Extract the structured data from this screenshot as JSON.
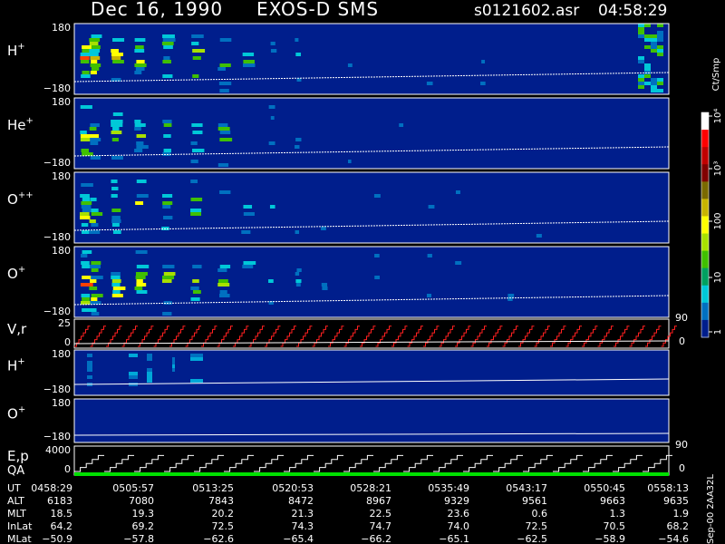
{
  "header": {
    "date": "Dec 16, 1990",
    "instrument": "EXOS-D SMS",
    "file": "s0121602.asr",
    "time": "04:58:29"
  },
  "colorbar": {
    "unit_label": "Ct/Smp",
    "ticks": [
      "10⁴",
      "10³",
      "100",
      "10",
      "1"
    ],
    "stops": [
      "#ffffff",
      "#ff0000",
      "#c00000",
      "#800000",
      "#7a6a00",
      "#c8b400",
      "#ffff00",
      "#a8e000",
      "#40c000",
      "#00a060",
      "#00c8d8",
      "#0070c0",
      "#001e8c"
    ]
  },
  "panels": [
    {
      "id": "h-plus",
      "label": "H",
      "sup": "+",
      "ytop": "180",
      "ybot": "−180",
      "kind": "spectrogram",
      "intensity": 1.0,
      "late": true
    },
    {
      "id": "he-plus",
      "label": "He",
      "sup": "+",
      "ytop": "180",
      "ybot": "−180",
      "kind": "spectrogram",
      "intensity": 0.75,
      "late": false
    },
    {
      "id": "o-plusplus",
      "label": "O",
      "sup": "++",
      "ytop": "180",
      "ybot": "−180",
      "kind": "spectrogram",
      "intensity": 0.8,
      "late": false
    },
    {
      "id": "o-plus",
      "label": "O",
      "sup": "+",
      "ytop": "180",
      "ybot": "−180",
      "kind": "spectrogram",
      "intensity": 0.95,
      "late": false
    },
    {
      "id": "v-r",
      "label": "V,r",
      "sup": "",
      "ytop": "25",
      "ybot": "0",
      "right": "90",
      "right2": "0",
      "kind": "sawtooth"
    },
    {
      "id": "h-plus-2",
      "label": "H",
      "sup": "+",
      "ytop": "180",
      "ybot": "−180",
      "kind": "spectrogram2"
    },
    {
      "id": "o-plus-2",
      "label": "O",
      "sup": "+",
      "ytop": "180",
      "ybot": "−180",
      "kind": "empty"
    },
    {
      "id": "e-p",
      "label": "E,p",
      "sup": "",
      "ytop": "4000",
      "ybot": "0",
      "right": "90",
      "right2": "0",
      "kind": "staircase"
    }
  ],
  "qa_label": "QA",
  "footer": {
    "rows": [
      {
        "label": "UT",
        "values": [
          "0458:29",
          "0505:57",
          "0513:25",
          "0520:53",
          "0528:21",
          "0535:49",
          "0543:17",
          "0550:45",
          "0558:13"
        ]
      },
      {
        "label": "ALT",
        "values": [
          "6183",
          "7080",
          "7843",
          "8472",
          "8967",
          "9329",
          "9561",
          "9663",
          "9635"
        ]
      },
      {
        "label": "MLT",
        "values": [
          "18.5",
          "19.3",
          "20.2",
          "21.3",
          "22.5",
          "23.6",
          "0.6",
          "1.3",
          "1.9"
        ]
      },
      {
        "label": "InLat",
        "values": [
          "64.2",
          "69.2",
          "72.5",
          "74.3",
          "74.7",
          "74.0",
          "72.5",
          "70.5",
          "68.2"
        ]
      },
      {
        "label": "MLat",
        "values": [
          "−50.9",
          "−57.8",
          "−62.6",
          "−65.4",
          "−66.2",
          "−65.1",
          "−62.5",
          "−58.9",
          "−54.6"
        ]
      }
    ],
    "stamp": "Sep-00  2AA32L"
  },
  "chart_data": {
    "type": "heatmap",
    "title": "Dec 16, 1990    EXOS-D SMS",
    "x": [
      "0458:29",
      "0505:57",
      "0513:25",
      "0520:53",
      "0528:21",
      "0535:49",
      "0543:17",
      "0550:45",
      "0558:13"
    ],
    "series": [
      {
        "name": "H+",
        "ylim": [
          -180,
          180
        ]
      },
      {
        "name": "He+",
        "ylim": [
          -180,
          180
        ]
      },
      {
        "name": "O++",
        "ylim": [
          -180,
          180
        ]
      },
      {
        "name": "O+",
        "ylim": [
          -180,
          180
        ]
      },
      {
        "name": "V,r",
        "ylim": [
          0,
          25
        ]
      },
      {
        "name": "H+",
        "ylim": [
          -180,
          180
        ]
      },
      {
        "name": "O+",
        "ylim": [
          -180,
          180
        ]
      },
      {
        "name": "E,p",
        "ylim": [
          0,
          4000
        ]
      }
    ],
    "colorbar_range": [
      1,
      10000
    ]
  }
}
